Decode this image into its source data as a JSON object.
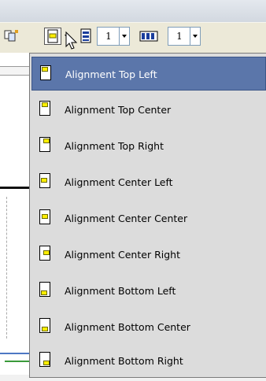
{
  "toolbar": {
    "spinner_left": {
      "value": "1"
    },
    "spinner_right": {
      "value": "1"
    }
  },
  "menu": {
    "items": [
      {
        "label": "Alignment Top Left",
        "selected": true
      },
      {
        "label": "Alignment Top Center"
      },
      {
        "label": "Alignment Top Right"
      },
      {
        "label": "Alignment Center Left"
      },
      {
        "label": "Alignment Center Center"
      },
      {
        "label": "Alignment Center Right"
      },
      {
        "label": "Alignment Bottom Left"
      },
      {
        "label": "Alignment Bottom Center"
      },
      {
        "label": "Alignment Bottom Right"
      }
    ]
  },
  "colors": {
    "selection": "#5b76aa",
    "icon_fill": "#ffee00",
    "toolbar": "#ece9d8"
  }
}
